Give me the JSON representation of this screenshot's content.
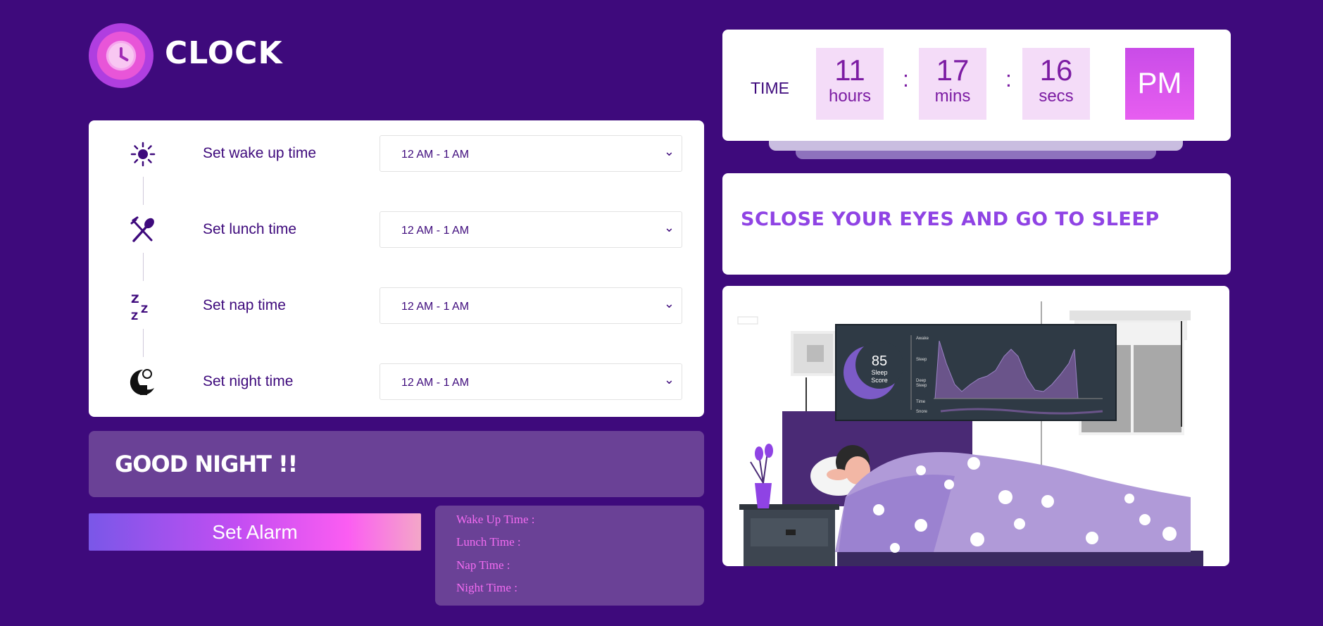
{
  "brand": {
    "name": "CLOCK",
    "logo_icon": "alarm-clock-icon"
  },
  "schedule": {
    "rows": [
      {
        "icon": "sun-icon",
        "label": "Set wake up time",
        "value": "12 AM - 1 AM"
      },
      {
        "icon": "utensils-icon",
        "label": "Set lunch time",
        "value": "12 AM - 1 AM"
      },
      {
        "icon": "zzz-sleep-icon",
        "label": "Set nap time",
        "value": "12 AM - 1 AM"
      },
      {
        "icon": "moon-icon",
        "label": "Set night time",
        "value": "12 AM - 1 AM"
      }
    ]
  },
  "greeting": "GOOD NIGHT !!",
  "set_alarm_label": "Set Alarm",
  "summary": {
    "wake": "Wake Up Time :",
    "lunch": "Lunch Time :",
    "nap": "Nap Time :",
    "night": "Night Time :"
  },
  "clock": {
    "label": "TIME",
    "hours": "11",
    "hours_unit": "hours",
    "mins": "17",
    "mins_unit": "mins",
    "secs": "16",
    "secs_unit": "secs",
    "sep": ":",
    "ampm": "PM"
  },
  "message": "SCLOSE YOUR EYES AND GO TO SLEEP",
  "illustration": {
    "score": "85",
    "score_label1": "Sleep",
    "score_label2": "Score",
    "rows": [
      "Awake",
      "Sleep",
      "Deep",
      "Sleep",
      "Time",
      "Snore"
    ]
  },
  "colors": {
    "background": "#3e0a7c",
    "panel": "#6a4196",
    "accent_pink": "#f36cf2",
    "accent_purple": "#8f43e4"
  }
}
